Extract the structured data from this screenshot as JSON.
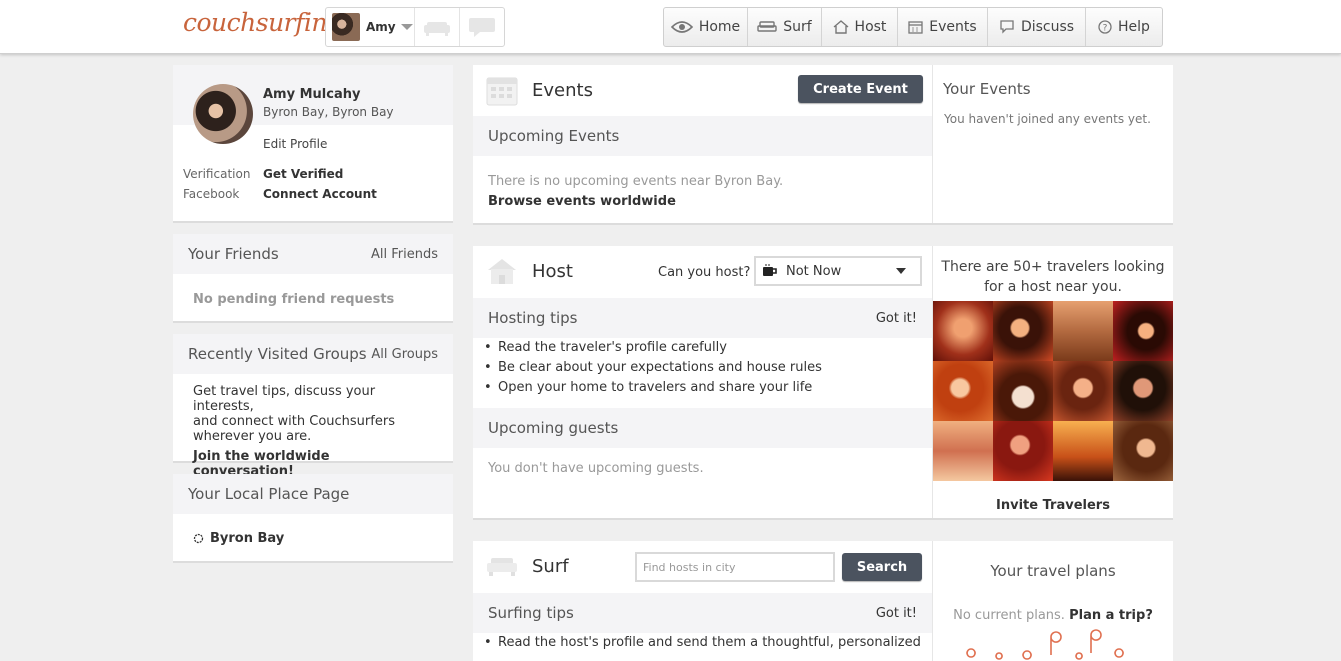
{
  "app": {
    "logo": "couchsurfing"
  },
  "user_menu": {
    "name": "Amy"
  },
  "nav": [
    {
      "label": "Home",
      "icon": "eye-icon"
    },
    {
      "label": "Surf",
      "icon": "couch-icon"
    },
    {
      "label": "Host",
      "icon": "house-icon"
    },
    {
      "label": "Events",
      "icon": "calendar-icon"
    },
    {
      "label": "Discuss",
      "icon": "chat-icon"
    },
    {
      "label": "Help",
      "icon": "question-icon"
    }
  ],
  "profile": {
    "name": "Amy Mulcahy",
    "location": "Byron Bay, Byron Bay",
    "edit_label": "Edit Profile",
    "verification_label": "Verification",
    "verification_action": "Get Verified",
    "facebook_label": "Facebook",
    "facebook_action": "Connect Account"
  },
  "friends": {
    "title": "Your Friends",
    "link": "All Friends",
    "empty": "No pending friend requests"
  },
  "groups": {
    "title": "Recently Visited Groups",
    "link": "All Groups",
    "line1": "Get travel tips, discuss your interests,",
    "line2": "and connect with Couchsurfers",
    "line3": "wherever you are.",
    "cta": "Join the worldwide conversation!"
  },
  "local_place": {
    "title": "Your Local Place Page",
    "place": "Byron Bay"
  },
  "events": {
    "title": "Events",
    "create_button": "Create Event",
    "upcoming_title": "Upcoming Events",
    "empty": "There is no upcoming events near Byron Bay.",
    "browse": "Browse events worldwide",
    "your_title": "Your Events",
    "your_empty": "You haven't joined any events yet."
  },
  "host": {
    "title": "Host",
    "can_host_label": "Can you host?",
    "can_host_value": "Not Now",
    "tips_title": "Hosting tips",
    "got_it": "Got it!",
    "tips": [
      "Read the traveler's profile carefully",
      "Be clear about your expectations and house rules",
      "Open your home to travelers and share your life"
    ],
    "guests_title": "Upcoming guests",
    "guests_empty": "You don't have upcoming guests.",
    "travelers_line1": "There are 50+ travelers looking",
    "travelers_line2": "for a host near you.",
    "invite": "Invite Travelers"
  },
  "surf": {
    "title": "Surf",
    "search_placeholder": "Find hosts in city",
    "search_button": "Search",
    "tips_title": "Surfing tips",
    "got_it": "Got it!",
    "tip1": "Read the host's profile and send them a thoughtful, personalized",
    "plans_title": "Your travel plans",
    "plans_empty": "No current plans.",
    "plan_link": "Plan a trip?"
  },
  "colors": {
    "logo": "#c8643c",
    "button_dark": "#4b535f",
    "panel_header": "#f4f4f6",
    "page_bg": "#efefef",
    "pin": "#e07050"
  }
}
